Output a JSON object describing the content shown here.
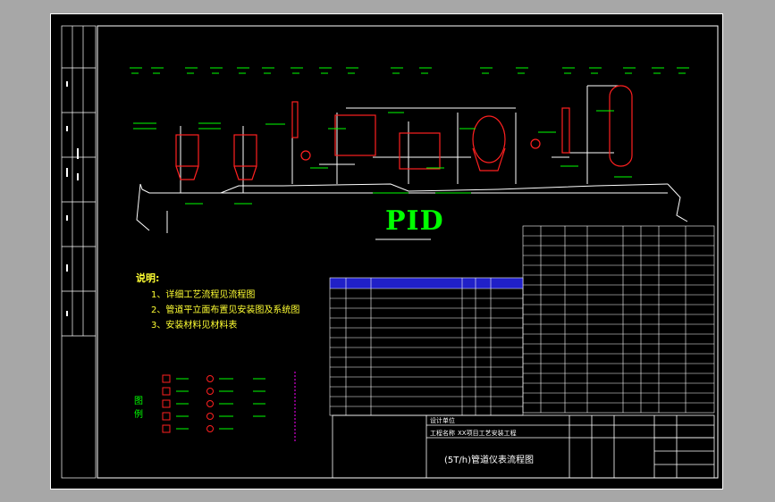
{
  "drawing": {
    "big_title": "PID",
    "notes_heading": "说明:",
    "notes": [
      "1、详细工艺流程见流程图",
      "2、管道平立面布置见安装图及系统图",
      "3、安装材料见材料表"
    ],
    "legend_heading": "图例",
    "title_block": {
      "designer_label": "设计单位",
      "project_label": "工程名称",
      "project_value": "XX项目工艺安装工程",
      "drawing_title": "(5T/h)管道仪表流程图"
    }
  },
  "colors": {
    "background": "#000000",
    "pipe_white": "#ffffff",
    "equipment_red": "#ff2020",
    "label_green": "#00ff00",
    "table_blue": "#3a3aff",
    "tag_magenta": "#ff00ff"
  }
}
